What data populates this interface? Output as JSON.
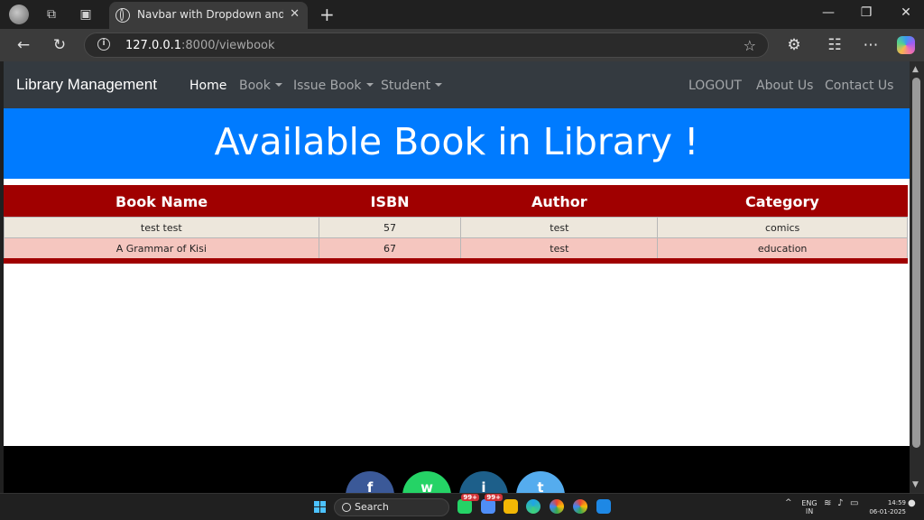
{
  "browser": {
    "tab_title": "Navbar with Dropdown and Searc",
    "tab_close": "✕",
    "new_tab": "+",
    "url_host": "127.0.0.1",
    "url_path": ":8000/viewbook",
    "window": {
      "minimize": "—",
      "restore": "❐",
      "close": "✕"
    }
  },
  "navbar": {
    "brand": "Library Management",
    "links": {
      "home": "Home",
      "book": "Book",
      "issue_book": "Issue Book",
      "student": "Student"
    },
    "right": {
      "logout": "LOGOUT",
      "about": "About Us",
      "contact": "Contact Us"
    }
  },
  "hero": {
    "title": "Available Book in Library !"
  },
  "table": {
    "headers": {
      "name": "Book Name",
      "isbn": "ISBN",
      "author": "Author",
      "category": "Category"
    },
    "rows": [
      {
        "name": "test test",
        "isbn": "57",
        "author": "test",
        "category": "comics"
      },
      {
        "name": "A Grammar of Kisi",
        "isbn": "67",
        "author": "test",
        "category": "education"
      }
    ]
  },
  "footer": {
    "social": {
      "facebook": "f",
      "whatsapp": "w",
      "instagram": "i",
      "twitter": "t"
    }
  },
  "taskbar": {
    "search_label": "Search",
    "badges": {
      "whatsapp": "99+",
      "browser": "99+"
    },
    "lang": {
      "top": "ENG",
      "bottom": "IN"
    },
    "time": "14:59",
    "date": "06-01-2025"
  },
  "colors": {
    "navbar": "#343a40",
    "hero": "#007bff",
    "table_header": "#a00000",
    "row_even": "#ede7dc",
    "row_odd": "#f5c6bf"
  }
}
